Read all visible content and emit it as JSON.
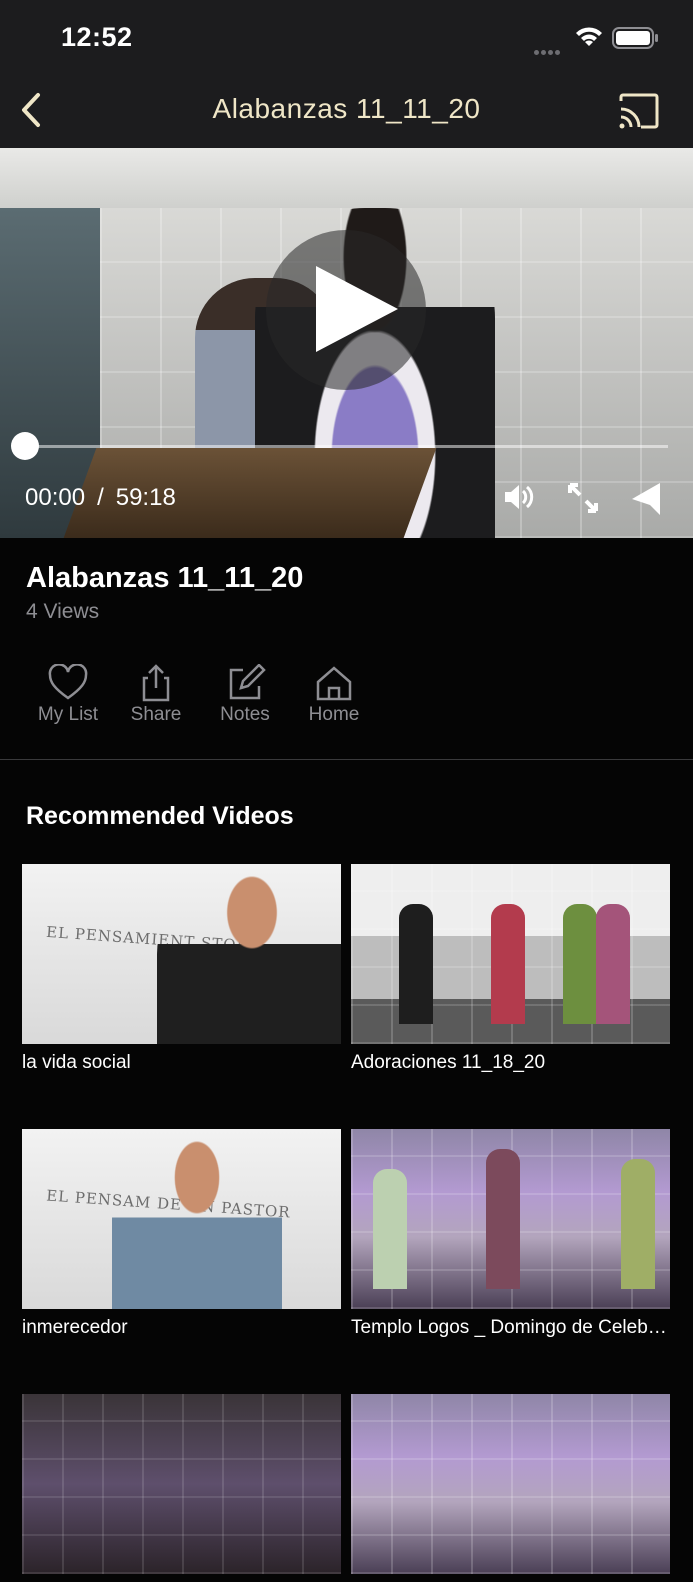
{
  "status_bar": {
    "time": "12:52"
  },
  "nav": {
    "title": "Alabanzas  11_11_20"
  },
  "player": {
    "current_time": "00:00",
    "separator": "/",
    "duration": "59:18",
    "progress": 0.0
  },
  "video": {
    "title": "Alabanzas  11_11_20",
    "views": "4 Views"
  },
  "actions": [
    {
      "label": "My List",
      "icon": "heart-icon"
    },
    {
      "label": "Share",
      "icon": "share-icon"
    },
    {
      "label": "Notes",
      "icon": "edit-icon"
    },
    {
      "label": "Home",
      "icon": "home-icon"
    }
  ],
  "recommended": {
    "heading": "Recommended Videos",
    "thumb_text": {
      "banner_1": "EL PENSAMIENT        STOR",
      "banner_2": "EL PENSAM      DE UN PASTOR"
    },
    "items": [
      {
        "title": "la vida social"
      },
      {
        "title": "Adoraciones  11_18_20"
      },
      {
        "title": "inmerecedor"
      },
      {
        "title": "Templo Logos _ Domingo de Celebración"
      },
      {
        "title": ""
      },
      {
        "title": ""
      }
    ]
  },
  "colors": {
    "topbar": "#1c1c1e",
    "title_accent": "#efe6c7",
    "muted": "#8e8e93",
    "background": "#050505"
  }
}
